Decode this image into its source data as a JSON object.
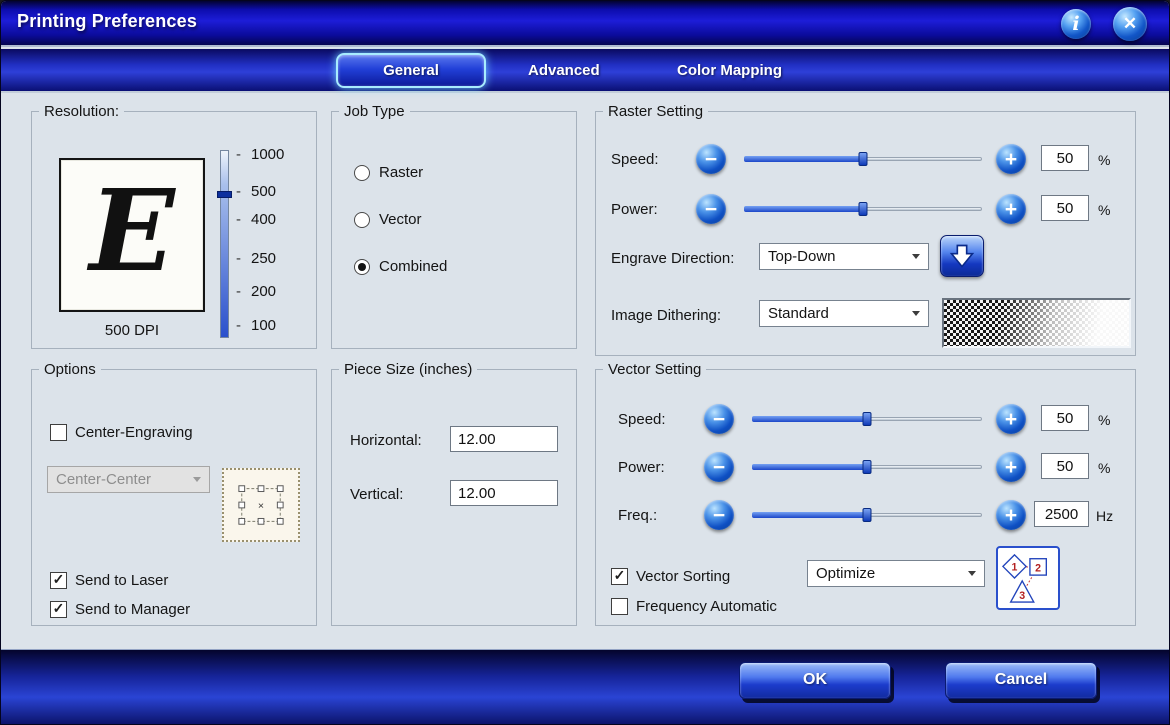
{
  "window": {
    "title": "Printing Preferences"
  },
  "glyphs": {
    "info": "i",
    "close": "✕",
    "plus": "+",
    "minus": "−",
    "check": "✓",
    "center_x": "×"
  },
  "tabs": {
    "items": [
      {
        "label": "General"
      },
      {
        "label": "Advanced"
      },
      {
        "label": "Color Mapping"
      }
    ],
    "active": "General"
  },
  "resolution": {
    "label": "Resolution:",
    "preview_letter": "E",
    "current": "500 DPI",
    "ticks": [
      "1000",
      "500",
      "400",
      "250",
      "200",
      "100"
    ]
  },
  "job_type": {
    "label": "Job Type",
    "options": [
      {
        "label": "Raster",
        "selected": false
      },
      {
        "label": "Vector",
        "selected": false
      },
      {
        "label": "Combined",
        "selected": true
      }
    ]
  },
  "raster": {
    "label": "Raster Setting",
    "speed": {
      "label": "Speed:",
      "value": "50",
      "unit": "%",
      "percent": 50
    },
    "power": {
      "label": "Power:",
      "value": "50",
      "unit": "%",
      "percent": 50
    },
    "engrave_direction": {
      "label": "Engrave Direction:",
      "value": "Top-Down"
    },
    "image_dithering": {
      "label": "Image Dithering:",
      "value": "Standard"
    }
  },
  "options": {
    "label": "Options",
    "center_engraving": {
      "label": "Center-Engraving",
      "checked": false
    },
    "center_position": {
      "value": "Center-Center",
      "enabled": false
    },
    "send_to_laser": {
      "label": "Send to Laser",
      "checked": true
    },
    "send_to_manager": {
      "label": "Send to Manager",
      "checked": true
    }
  },
  "piece_size": {
    "label": "Piece Size (inches)",
    "horizontal": {
      "label": "Horizontal:",
      "value": "12.00"
    },
    "vertical": {
      "label": "Vertical:",
      "value": "12.00"
    }
  },
  "vector": {
    "label": "Vector Setting",
    "speed": {
      "label": "Speed:",
      "value": "50",
      "unit": "%",
      "percent": 50
    },
    "power": {
      "label": "Power:",
      "value": "50",
      "unit": "%",
      "percent": 50
    },
    "freq": {
      "label": "Freq.:",
      "value": "2500",
      "unit": "Hz",
      "percent": 50
    },
    "vector_sorting": {
      "label": "Vector Sorting",
      "checked": true
    },
    "sorting_mode": {
      "value": "Optimize"
    },
    "sort_icon_numbers": [
      "1",
      "2",
      "3"
    ],
    "frequency_automatic": {
      "label": "Frequency Automatic",
      "checked": false
    }
  },
  "footer": {
    "ok": "OK",
    "cancel": "Cancel"
  }
}
